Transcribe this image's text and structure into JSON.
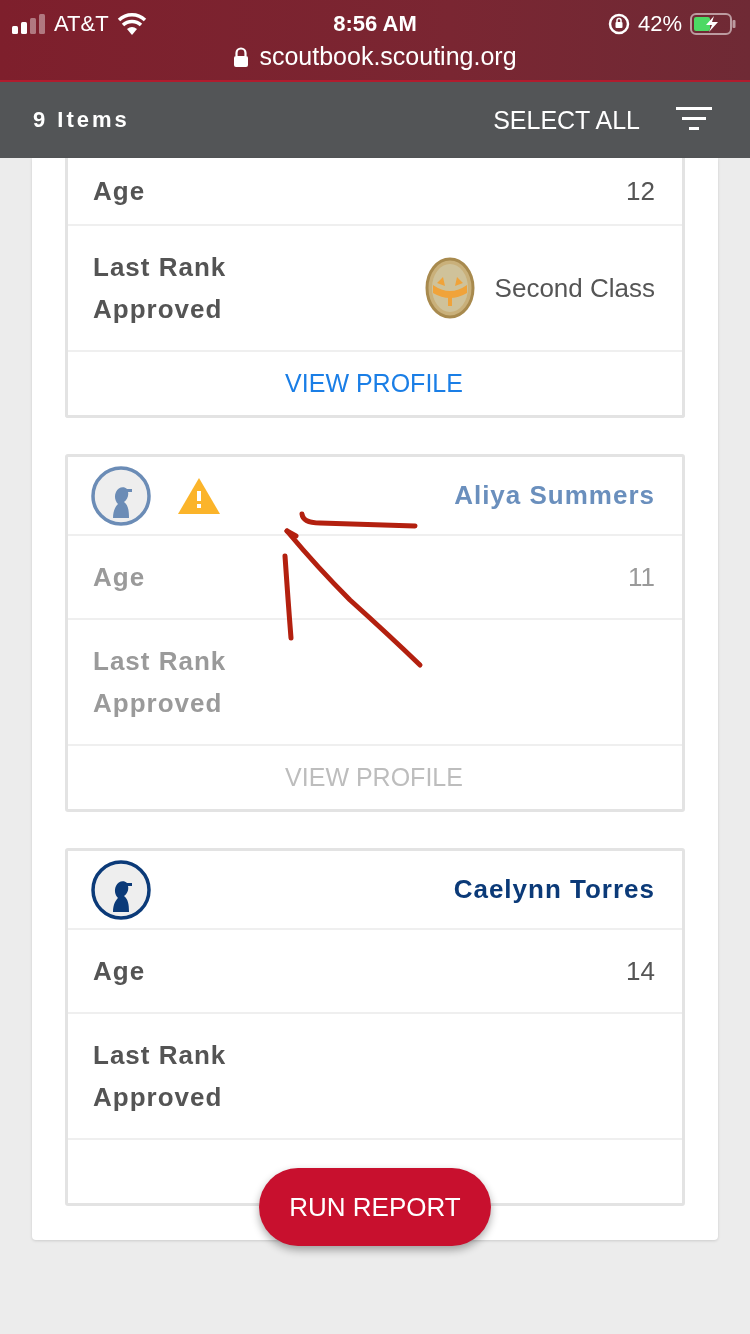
{
  "status_bar": {
    "carrier": "AT&T",
    "time": "8:56 AM",
    "battery": "42%",
    "url": "scoutbook.scouting.org"
  },
  "toolbar": {
    "count": "9 Items",
    "select_all": "SELECT ALL"
  },
  "cards": [
    {
      "age_label": "Age",
      "age": "12",
      "rank_label": "Last Rank Approved",
      "rank": "Second Class",
      "link": "VIEW PROFILE",
      "inactive": false
    },
    {
      "name": "Aliya Summers",
      "warning": true,
      "age_label": "Age",
      "age": "11",
      "rank_label": "Last Rank Approved",
      "link": "VIEW PROFILE",
      "inactive": true
    },
    {
      "name": "Caelynn Torres",
      "warning": false,
      "age_label": "Age",
      "age": "14",
      "rank_label": "Last Rank Approved",
      "inactive": false
    }
  ],
  "run_report": "RUN REPORT"
}
